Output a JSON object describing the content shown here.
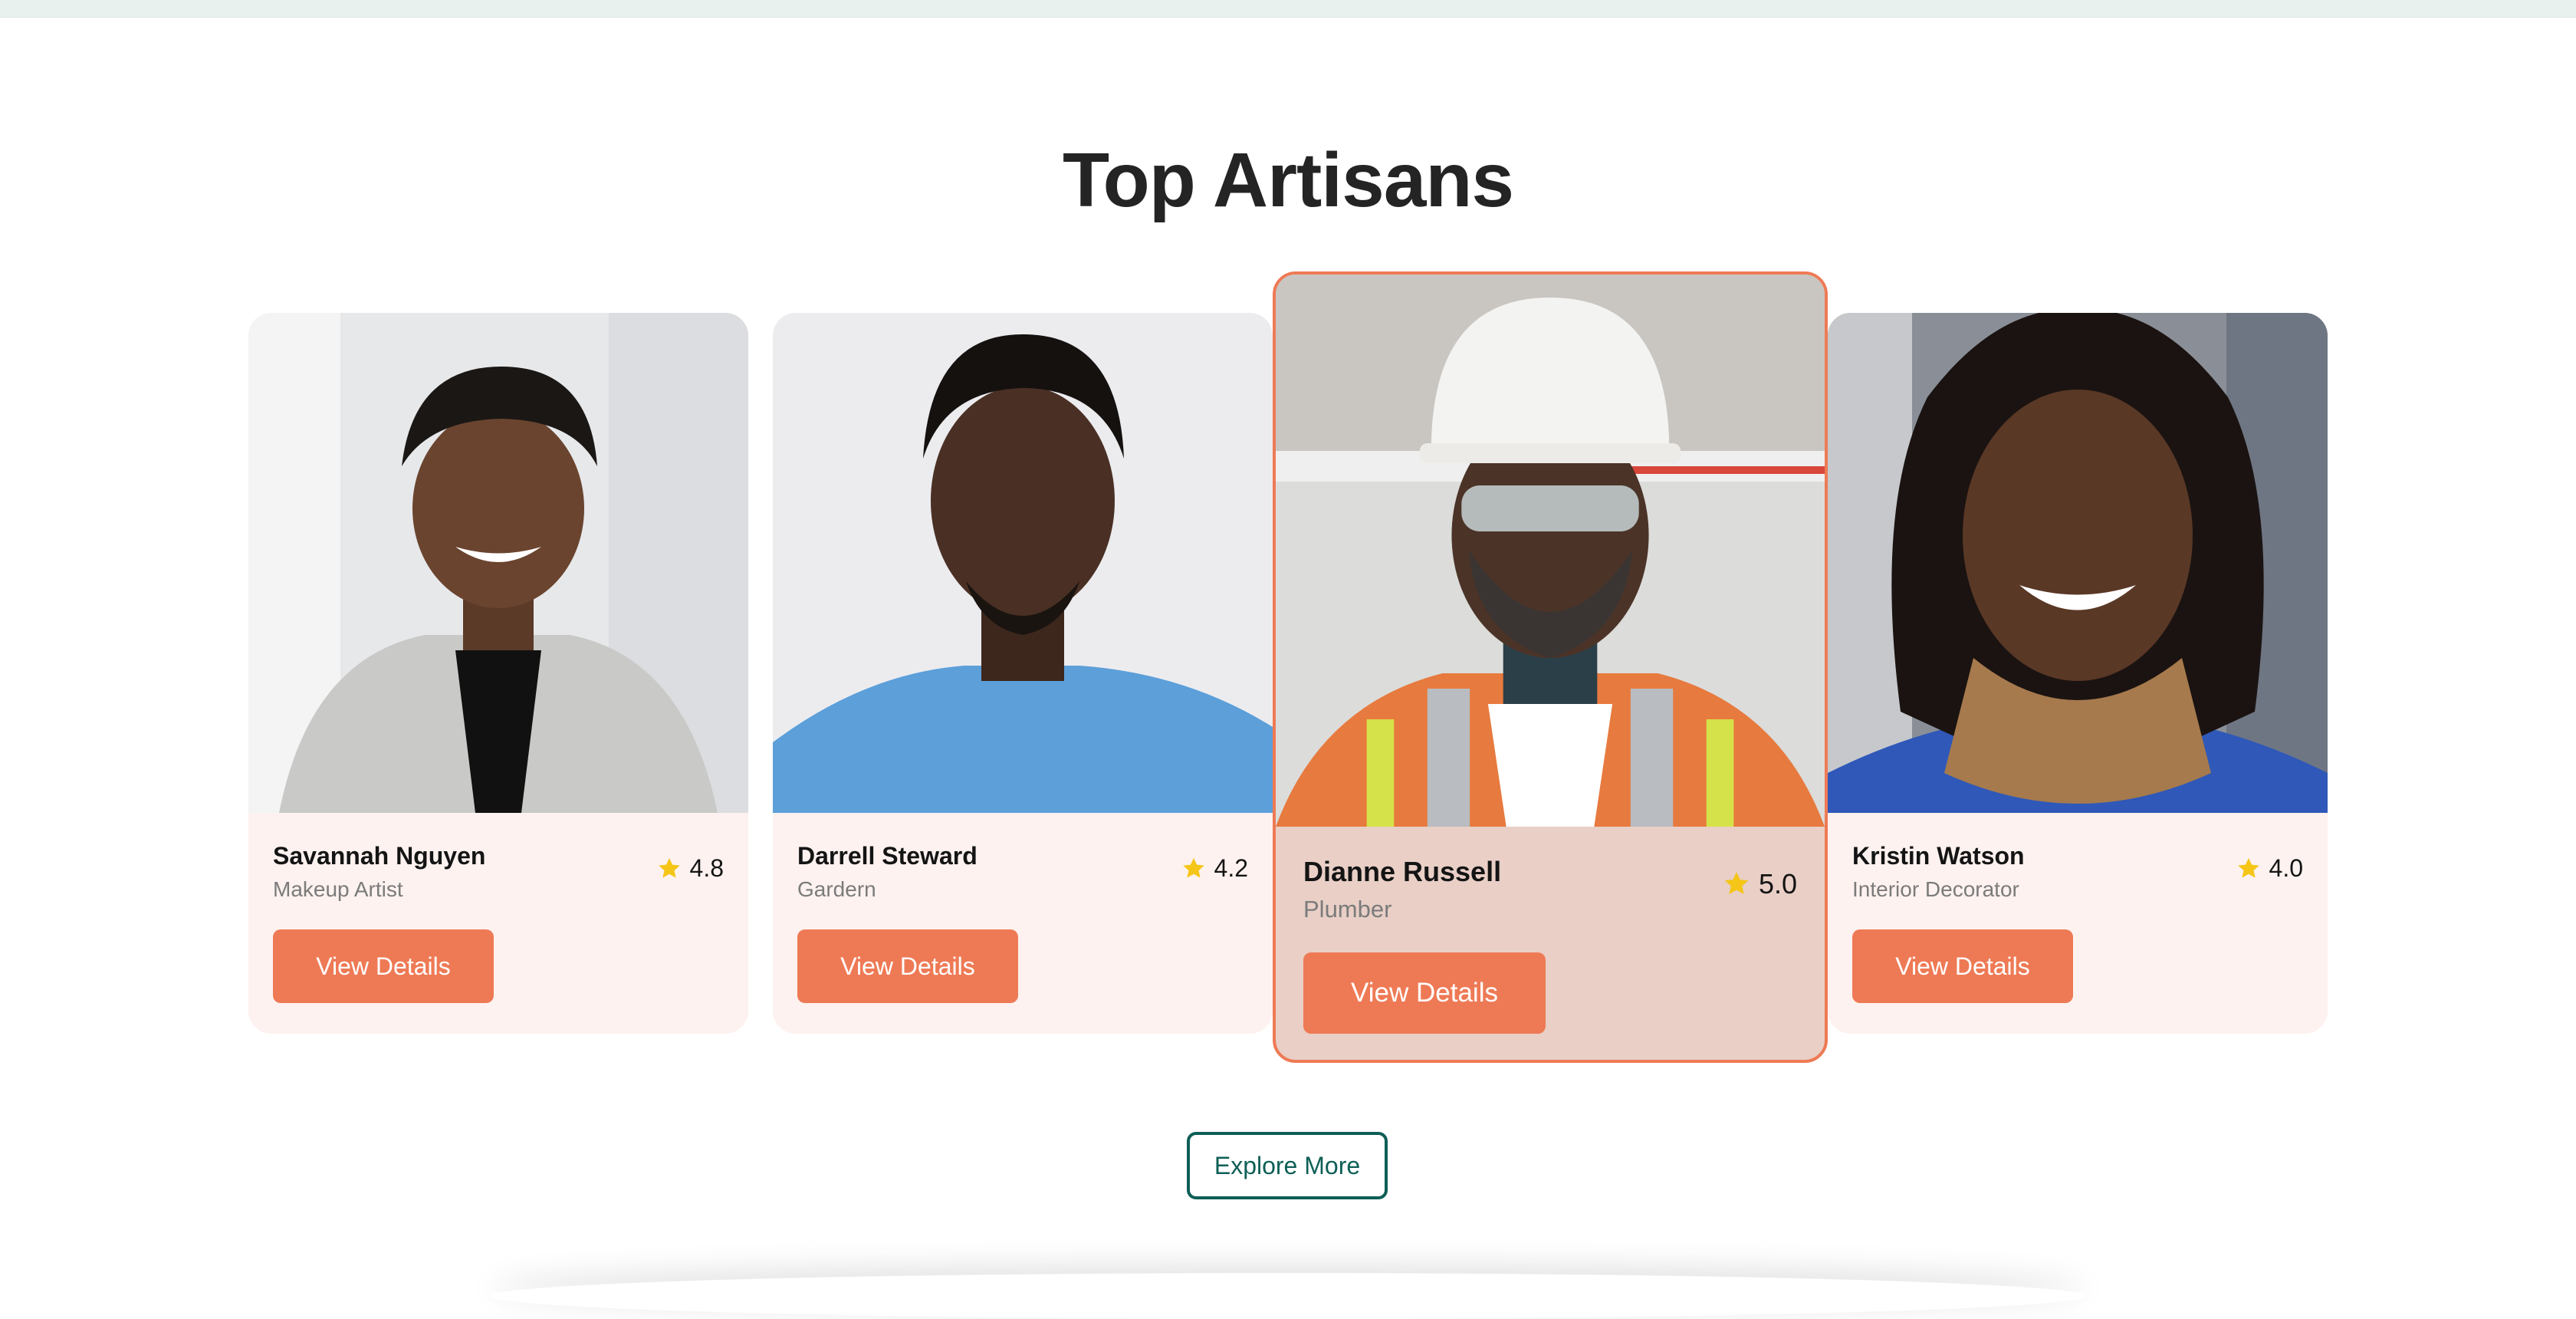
{
  "section": {
    "title": "Top Artisans",
    "explore_label": "Explore More"
  },
  "colors": {
    "accent": "#ee7a55",
    "card_bg": "#fdf2ef",
    "featured_bg": "#e9cfc6",
    "explore_border": "#0e5f56",
    "star": "#f5c518"
  },
  "artisans": [
    {
      "name": "Savannah Nguyen",
      "role": "Makeup Artist",
      "rating": "4.8",
      "button_label": "View Details",
      "featured": false
    },
    {
      "name": "Darrell Steward",
      "role": "Gardern",
      "rating": "4.2",
      "button_label": "View Details",
      "featured": false
    },
    {
      "name": "Dianne Russell",
      "role": "Plumber",
      "rating": "5.0",
      "button_label": "View Details",
      "featured": true
    },
    {
      "name": "Kristin Watson",
      "role": "Interior Decorator",
      "rating": "4.0",
      "button_label": "View Details",
      "featured": false
    }
  ],
  "icons": {
    "rating": "star-icon"
  }
}
